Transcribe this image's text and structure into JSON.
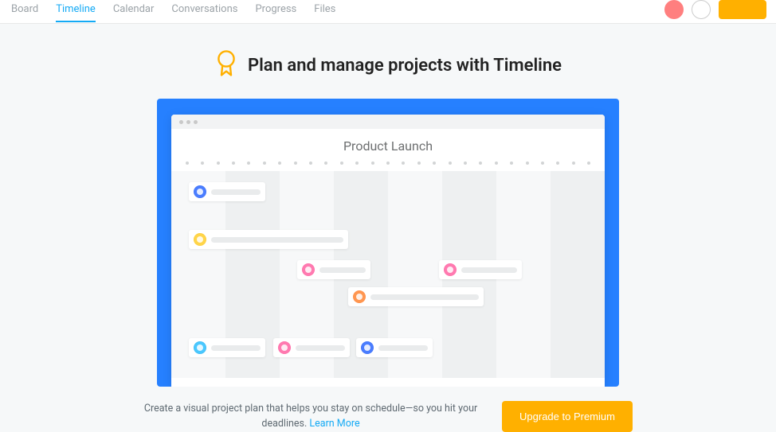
{
  "tabs": {
    "board": "Board",
    "timeline": "Timeline",
    "calendar": "Calendar",
    "conversations": "Conversations",
    "progress": "Progress",
    "files": "Files"
  },
  "active_tab": "timeline",
  "headline": "Plan and manage projects with Timeline",
  "mock": {
    "title": "Product Launch"
  },
  "footer": {
    "text": "Create a visual project plan that helps you stay on schedule—so you hit your deadlines.",
    "link": "Learn More",
    "upgrade": "Upgrade to Premium"
  }
}
